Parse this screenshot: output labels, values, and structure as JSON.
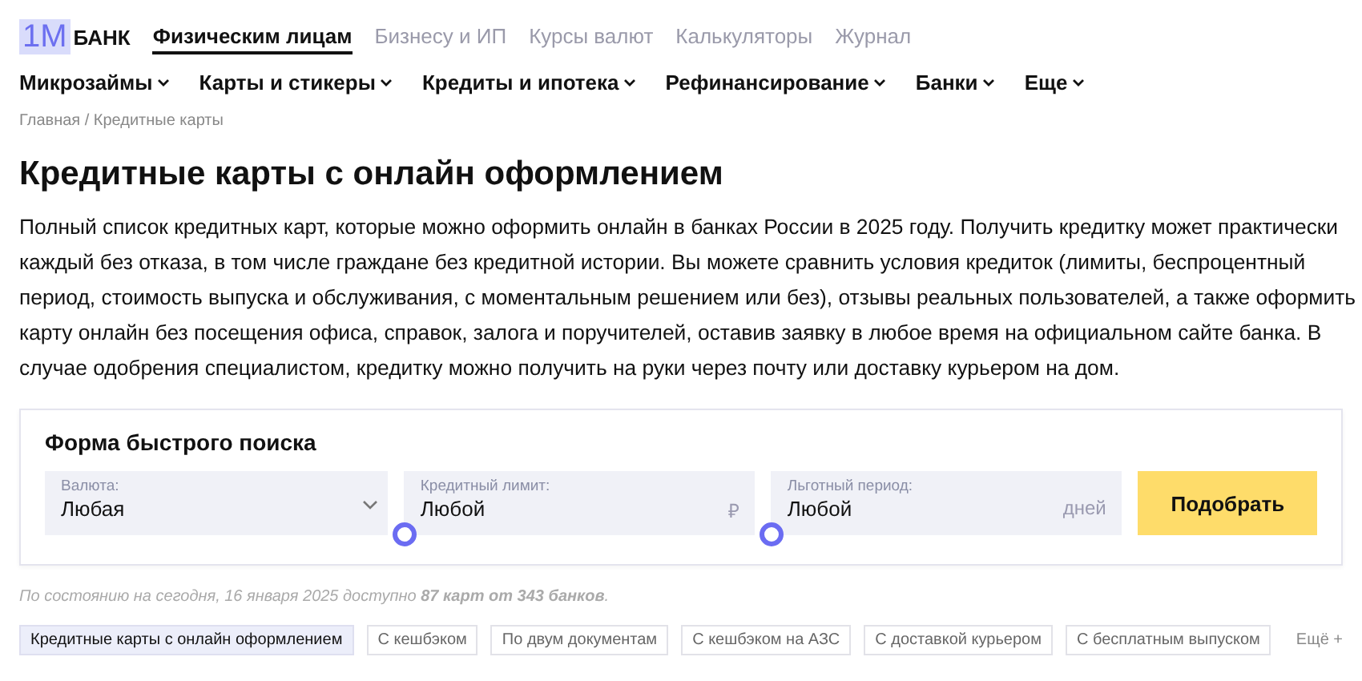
{
  "logo": {
    "mark": "1M",
    "name": "БАНК"
  },
  "top_nav": [
    {
      "label": "Физическим лицам",
      "selected": true
    },
    {
      "label": "Бизнесу и ИП",
      "selected": false
    },
    {
      "label": "Курсы валют",
      "selected": false
    },
    {
      "label": "Калькуляторы",
      "selected": false
    },
    {
      "label": "Журнал",
      "selected": false
    }
  ],
  "main_nav": [
    "Микрозаймы",
    "Карты и стикеры",
    "Кредиты и ипотека",
    "Рефинансирование",
    "Банки",
    "Еще"
  ],
  "breadcrumb": "Главная / Кредитные карты",
  "title": "Кредитные карты с онлайн оформлением",
  "intro": "Полный список кредитных карт, которые можно оформить онлайн в банках России в 2025 году. Получить кредитку может практически каждый без отказа, в том числе граждане без кредитной истории. Вы можете сравнить условия кредиток (лимиты, беспроцентный период, стоимость выпуска и обслуживания, с моментальным решением или без), отзывы реальных пользователей, а также оформить карту онлайн без посещения офиса, справок, залога и поручителей, оставив заявку в любое время на официальном сайте банка. В случае одобрения специалистом, кредитку можно получить на руки через почту или доставку курьером на дом.",
  "search_form": {
    "title": "Форма быстрого поиска",
    "fields": [
      {
        "kind": "select",
        "label": "Валюта:",
        "value": "Любая"
      },
      {
        "kind": "slider",
        "label": "Кредитный лимит:",
        "value": "Любой",
        "unit": "₽",
        "level": 0
      },
      {
        "kind": "slider",
        "label": "Льготный период:",
        "value": "Любой",
        "unit": "дней",
        "level": 0
      }
    ],
    "button": "Подобрать"
  },
  "status": "По состоянию на сегодня, 16 января 2025 доступно **87 карт от 343 банков**.",
  "tags": [
    {
      "label": "Кредитные карты с онлайн оформлением",
      "selected": true
    },
    {
      "label": "С кешбэком",
      "selected": false
    },
    {
      "label": "По двум документам",
      "selected": false
    },
    {
      "label": "С кешбэком на АЗС",
      "selected": false
    },
    {
      "label": "С доставкой курьером",
      "selected": false
    },
    {
      "label": "С бесплатным выпуском",
      "selected": false
    }
  ],
  "more_tags": "Ещё +"
}
